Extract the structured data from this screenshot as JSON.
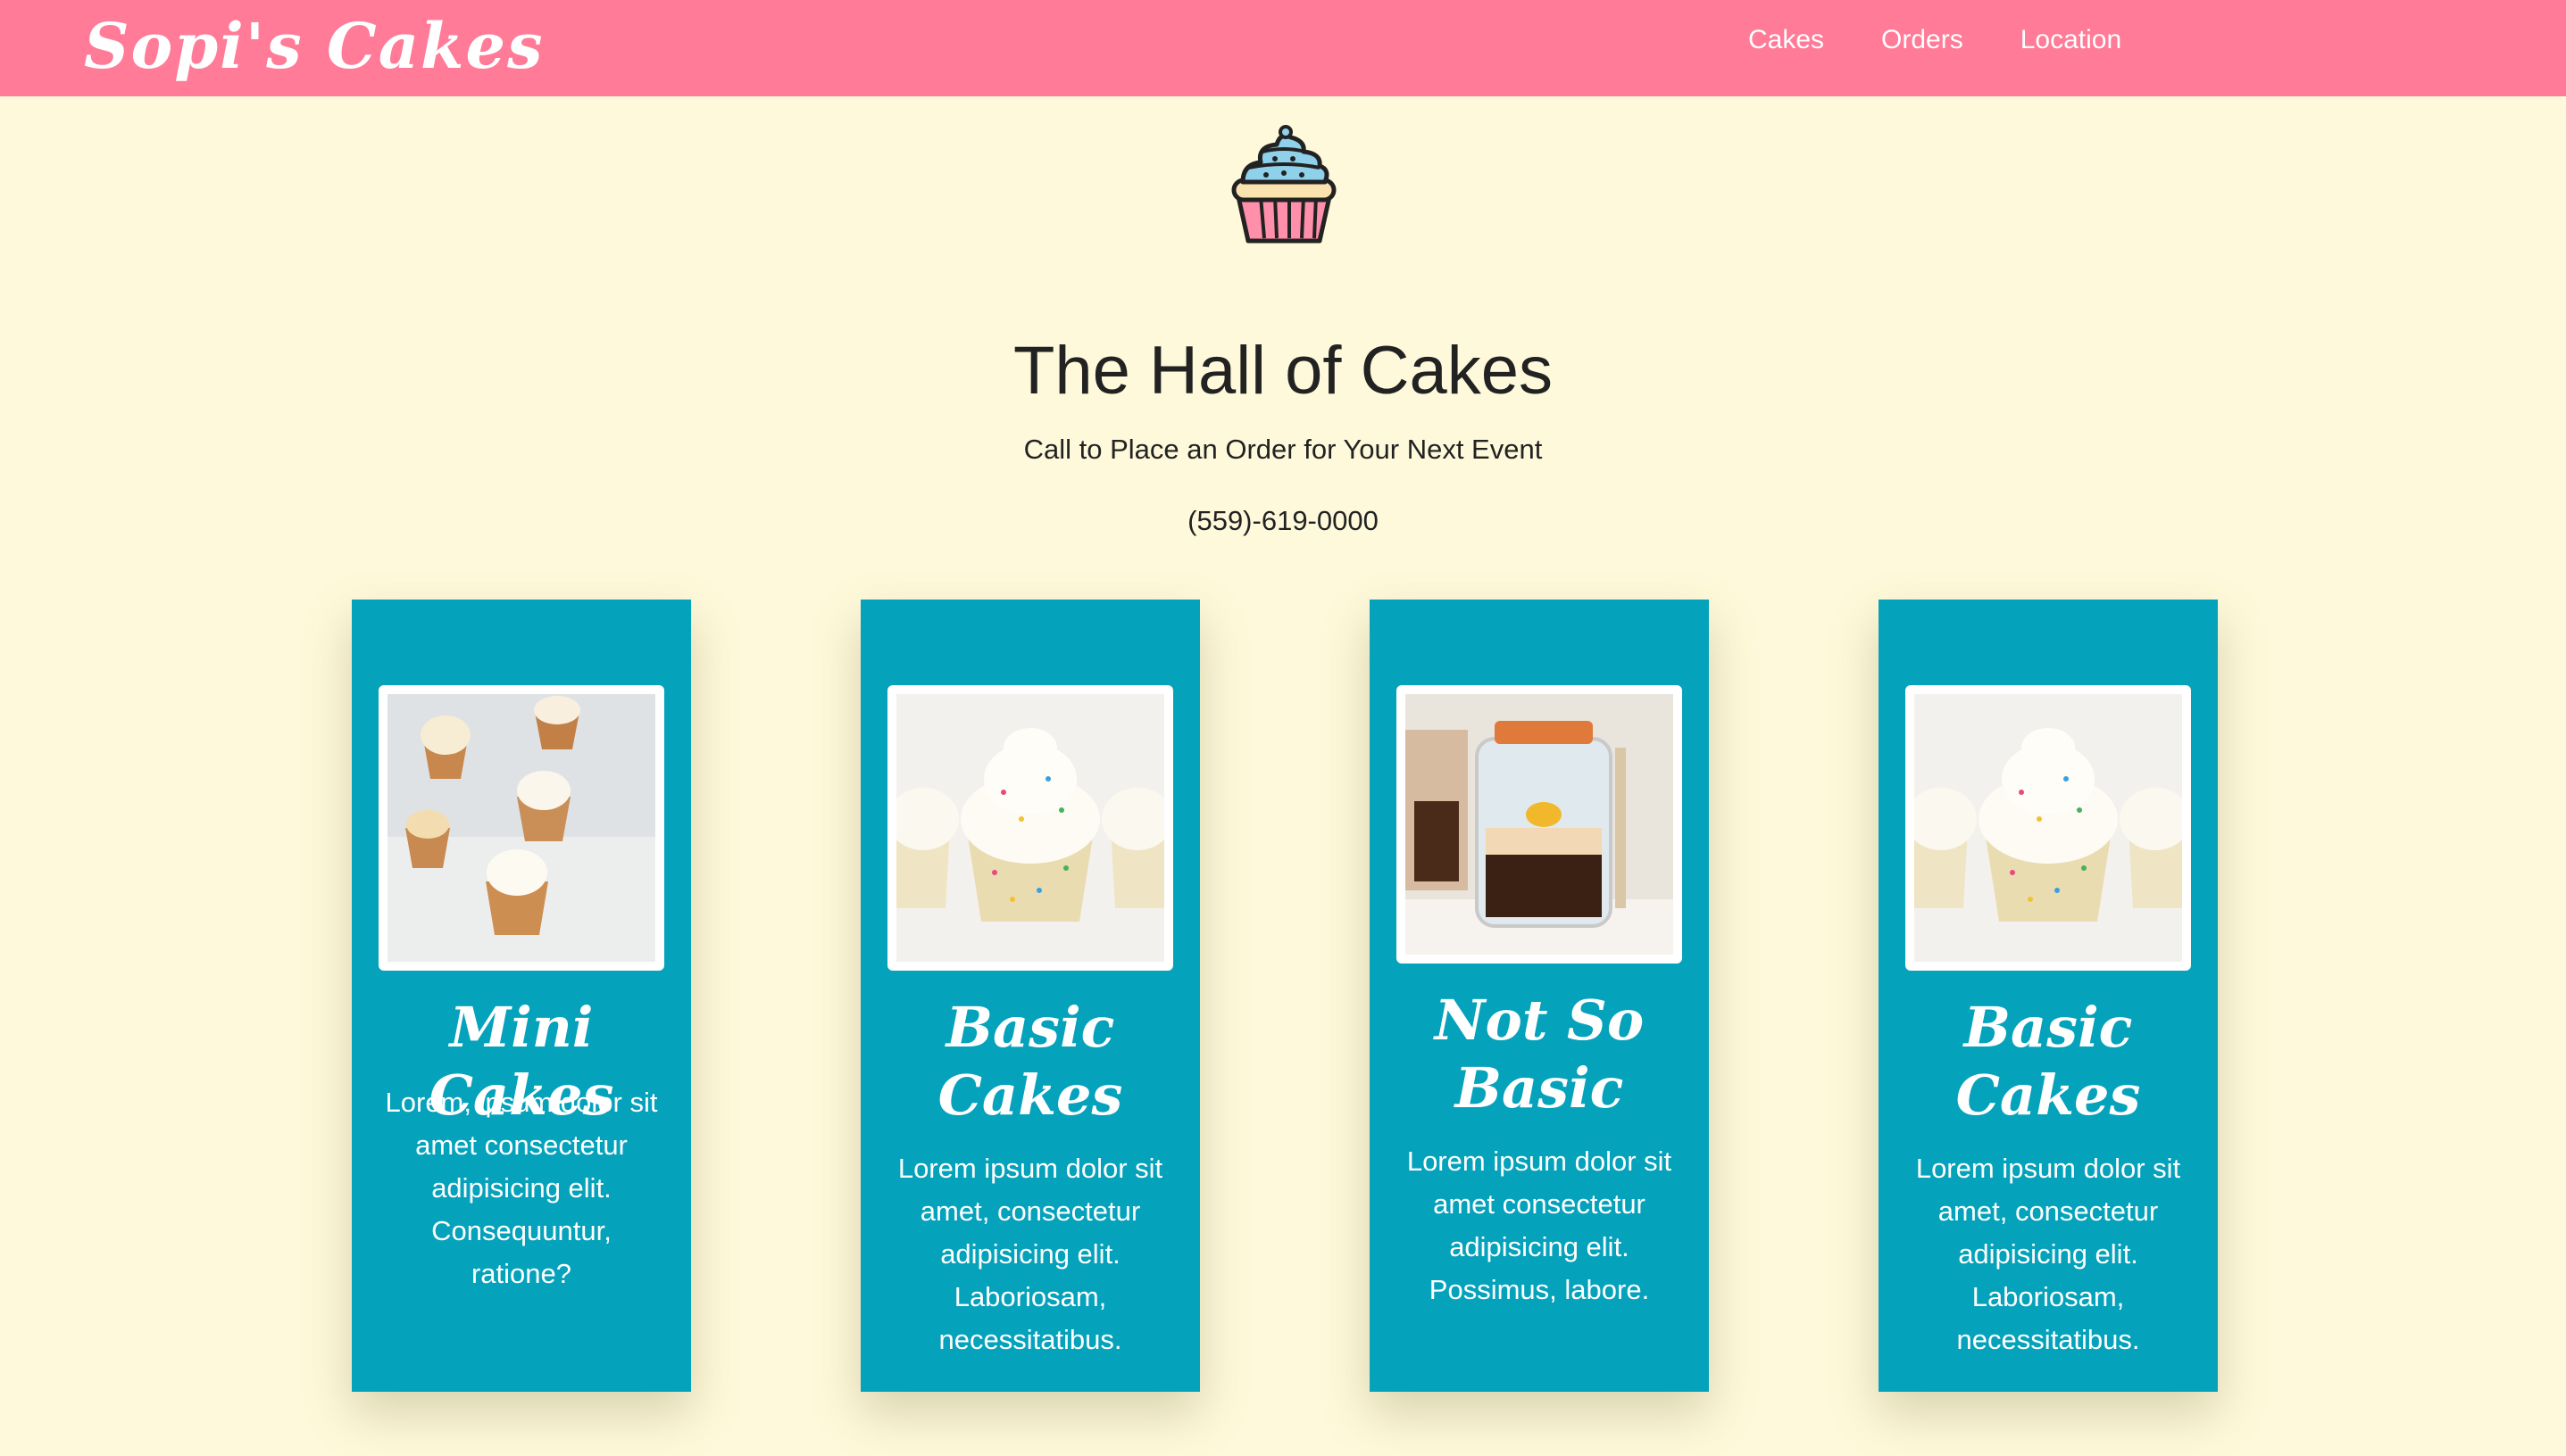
{
  "nav": {
    "brand": "Sopi's Cakes",
    "links": [
      "Cakes",
      "Orders",
      "Location"
    ]
  },
  "hero": {
    "title": "The Hall of Cakes",
    "subtitle": "Call to Place an Order for Your Next Event",
    "phone": "(559)-619-0000"
  },
  "cards": [
    {
      "title": "Mini Cakes",
      "text": "Lorem, ipsum dolor sit amet consectetur adipisicing elit. Consequuntur, ratione?"
    },
    {
      "title": "Basic Cakes",
      "text": "Lorem ipsum dolor sit amet, consectetur adipisicing elit. Laboriosam, necessitatibus."
    },
    {
      "title": "Not So Basic",
      "text": "Lorem ipsum dolor sit amet consectetur adipisicing elit. Possimus, labore."
    },
    {
      "title": "Basic Cakes",
      "text": "Lorem ipsum dolor sit amet, consectetur adipisicing elit. Laboriosam, necessitatibus."
    }
  ],
  "colors": {
    "navbar": "#ff7b97",
    "background": "#fef9da",
    "card": "#05a2bb"
  },
  "icons": {
    "logo": "cupcake-icon"
  }
}
